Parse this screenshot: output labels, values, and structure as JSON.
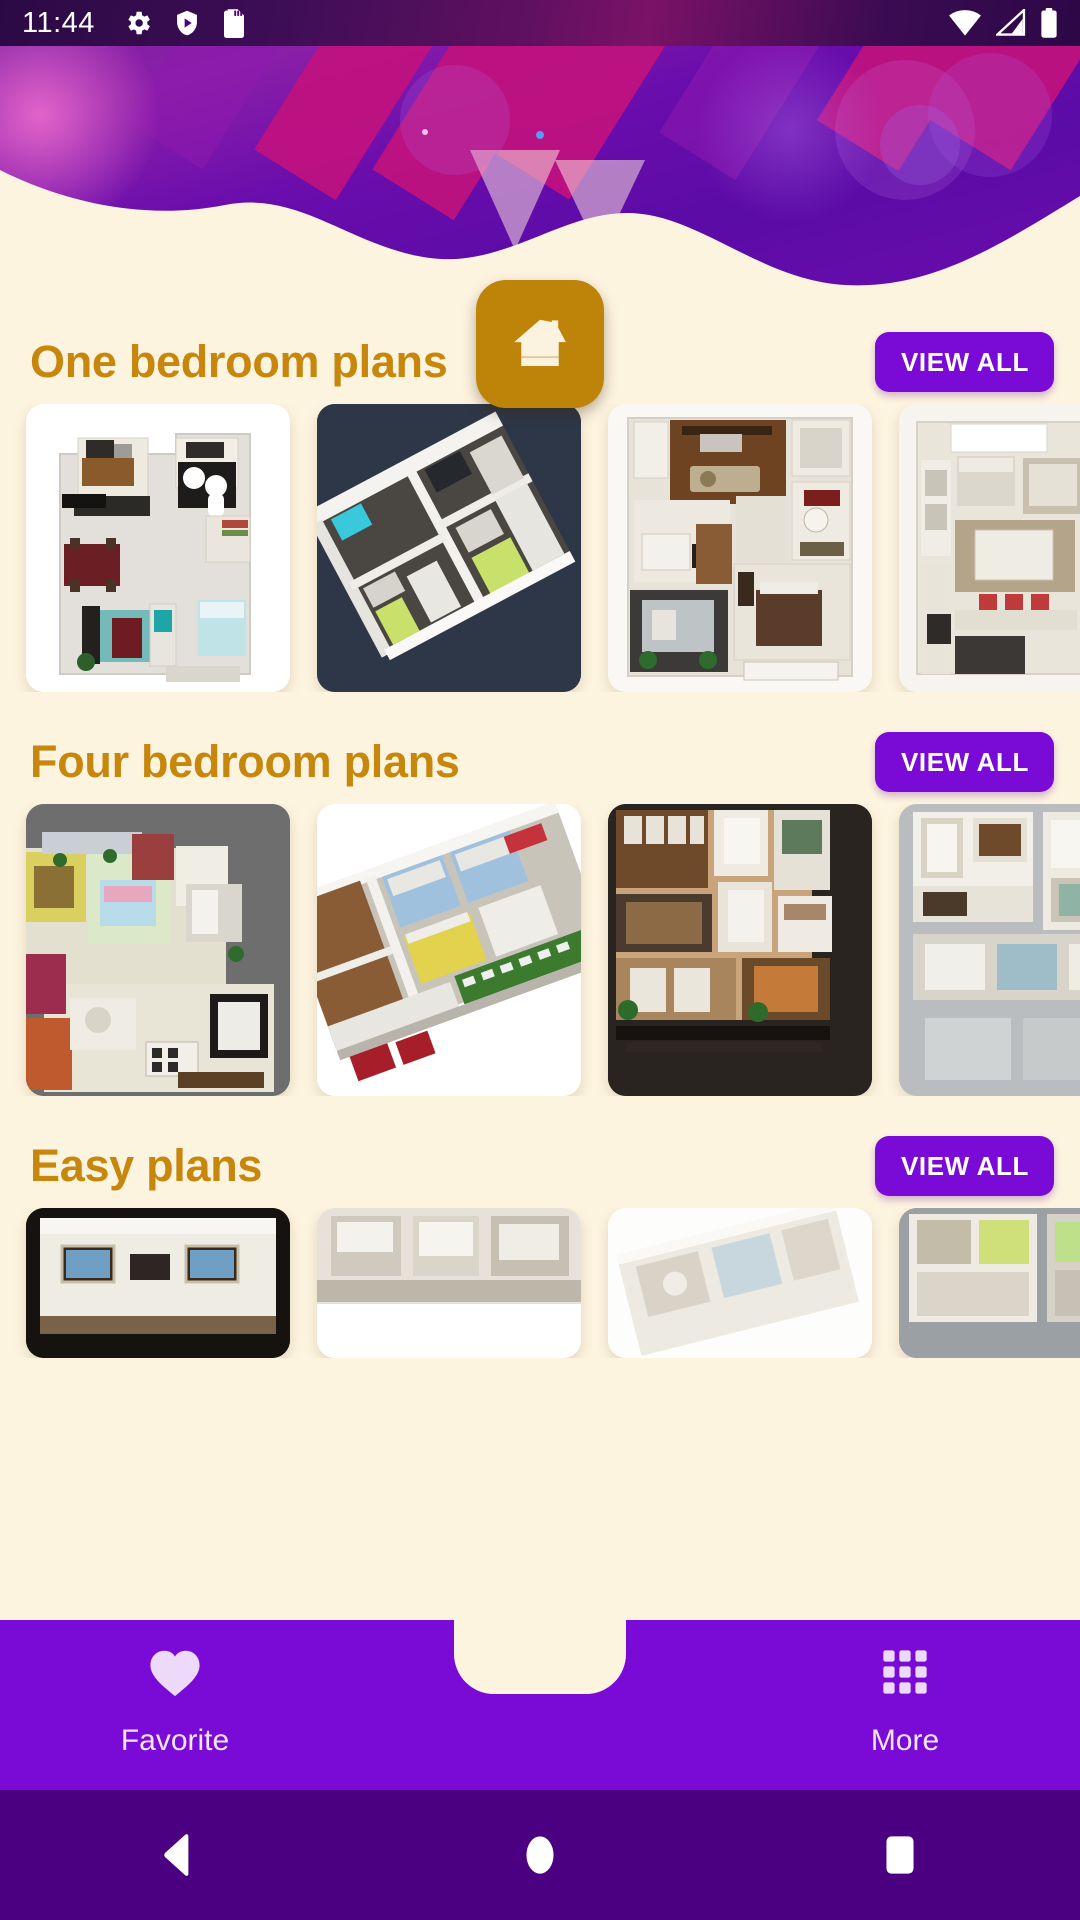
{
  "status_bar": {
    "time": "11:44",
    "left_icons": [
      "gear-icon",
      "play-protect-shield-icon",
      "sd-card-icon"
    ],
    "right_icons": [
      "wifi-icon",
      "cell-signal-icon",
      "battery-icon"
    ]
  },
  "header": {
    "banner_colors": {
      "purple_dark": "#4B0082",
      "purple_mid": "#6A0DAD",
      "magenta": "#C2127E",
      "pink_accent": "#E0218A"
    }
  },
  "theme": {
    "background": "#FDF4E0",
    "title_gold": "#C6870C",
    "accent_purple": "#7A0BD6",
    "fab_gold": "#BD8409",
    "nav_purple": "#4B0082"
  },
  "sections": [
    {
      "title": "One bedroom plans",
      "view_all_label": "VIEW ALL",
      "cards": [
        {
          "name": "one-bedroom-plan-1",
          "bg": "#ffffff",
          "style": "topdown-white"
        },
        {
          "name": "one-bedroom-plan-2",
          "bg": "#2E3748",
          "style": "iso-dark"
        },
        {
          "name": "one-bedroom-plan-3",
          "bg": "#ffffff",
          "style": "topdown-wood"
        },
        {
          "name": "one-bedroom-plan-4",
          "bg": "#ffffff",
          "style": "topdown-light"
        }
      ]
    },
    {
      "title": "Four bedroom plans",
      "view_all_label": "VIEW ALL",
      "cards": [
        {
          "name": "four-bedroom-plan-1",
          "bg": "#6E6E6E",
          "style": "topdown-grey"
        },
        {
          "name": "four-bedroom-plan-2",
          "bg": "#ffffff",
          "style": "iso-white"
        },
        {
          "name": "four-bedroom-plan-3",
          "bg": "#2A2421",
          "style": "topdown-dark"
        },
        {
          "name": "four-bedroom-plan-4",
          "bg": "#BFC2C4",
          "style": "topdown-grey2"
        }
      ]
    },
    {
      "title": "Easy plans",
      "view_all_label": "VIEW ALL",
      "cards": [
        {
          "name": "easy-plan-1",
          "bg": "#16120F",
          "style": "room-dark"
        },
        {
          "name": "easy-plan-2",
          "bg": "#ffffff",
          "style": "room-white"
        },
        {
          "name": "easy-plan-3",
          "bg": "#ffffff",
          "style": "room-light"
        },
        {
          "name": "easy-plan-4",
          "bg": "#9AA0A4",
          "style": "room-grey"
        }
      ]
    }
  ],
  "bottom_nav": {
    "favorite_label": "Favorite",
    "more_label": "More",
    "fab_icon": "home-icon"
  },
  "android_nav": {
    "back": "back-triangle-icon",
    "home": "home-circle-icon",
    "recents": "recents-square-icon"
  }
}
